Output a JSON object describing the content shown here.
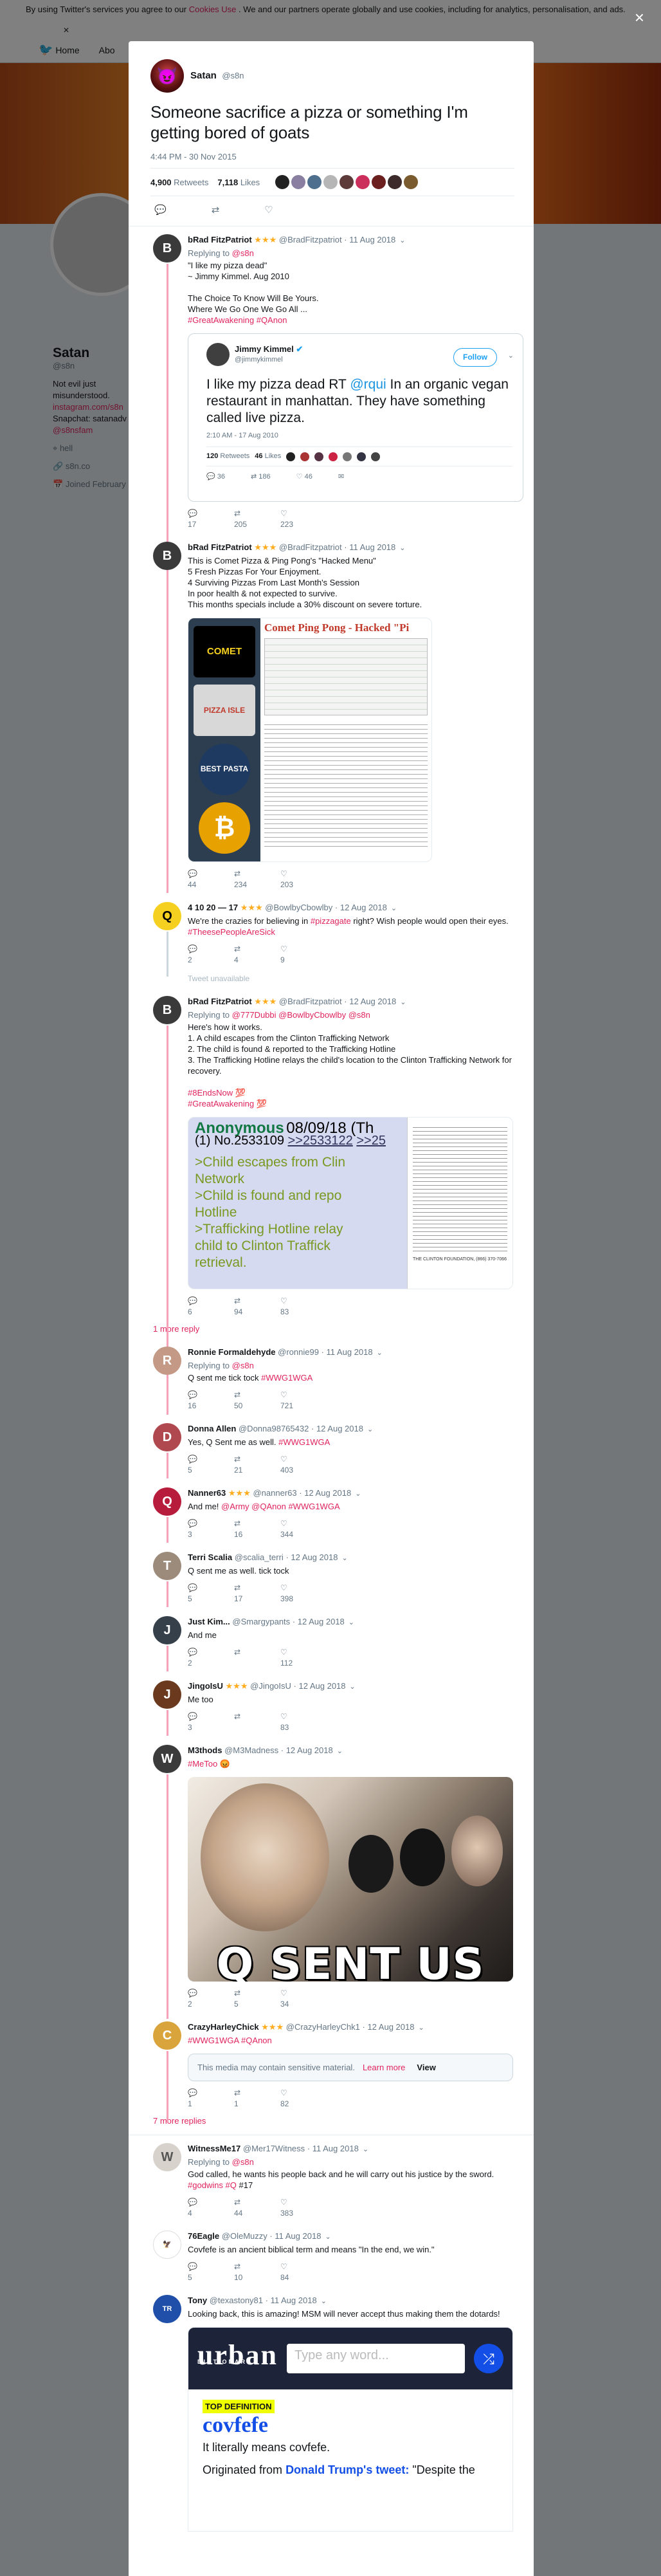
{
  "background": {
    "cookie_text": "By using Twitter's services you agree to our",
    "cookie_link": "Cookies Use",
    "cookie_rest": ". We and our partners operate globally and use cookies, including for analytics, personalisation, and ads.",
    "nav_home": "Home",
    "nav_about": "Abo",
    "profile_name": "Satan",
    "profile_handle": "@s8n",
    "bio_1": "Not evil just misunderstood.",
    "bio_2": "instagram.com/s8n",
    "bio_3": "Snapchat: satanadv",
    "bio_4": "@s8nsfam",
    "location": "hell",
    "website": "s8n.co",
    "joined": "Joined February"
  },
  "modal": {
    "close_label": "×",
    "author_name": "Satan",
    "author_handle": "@s8n",
    "text": "Someone sacrifice a pizza or something I'm getting bored of goats",
    "time": "4:44 PM - 30 Nov 2015",
    "retweets_count": "4,900",
    "retweets_label": "Retweets",
    "likes_count": "7,118",
    "likes_label": "Likes"
  },
  "replies": [
    {
      "name": "bRad FitzPatriot",
      "stars": "★★★",
      "handle": "@BradFitzpatriot",
      "time": "11 Aug 2018",
      "replying_label": "Replying to",
      "replying_to": "@s8n",
      "lines": [
        "\"I like my pizza dead\"",
        "~ Jimmy Kimmel. Aug 2010",
        "",
        "The Choice To Know Will Be Yours.",
        "Where We Go One We Go All ..."
      ],
      "tags": "#GreatAwakening #QAnon",
      "replies": "17",
      "retweets": "205",
      "likes": "223"
    },
    {
      "name": "bRad FitzPatriot",
      "stars": "★★★",
      "handle": "@BradFitzpatriot",
      "time": "11 Aug 2018",
      "lines": [
        "This is Comet Pizza & Ping Pong's \"Hacked Menu\"",
        "5 Fresh Pizzas For Your Enjoyment.",
        "4 Surviving Pizzas From Last Month's Session",
        "In poor health & not expected to survive.",
        "This months specials include a 30% discount on severe torture."
      ],
      "replies": "44",
      "retweets": "234",
      "likes": "203"
    },
    {
      "name": "4 10 20 — 17",
      "stars": "★★★",
      "handle": "@BowlbyCbowlby",
      "time": "12 Aug 2018",
      "text_a": "We're the crazies for believing in ",
      "text_tag": "#pizzagate",
      "text_b": " right? Wish people would open their eyes. ",
      "text_tag2": "#TheesePeopleAreSick",
      "replies": "2",
      "retweets": "4",
      "likes": "9",
      "unavailable": "Tweet unavailable"
    },
    {
      "name": "bRad FitzPatriot",
      "stars": "★★★",
      "handle": "@BradFitzpatriot",
      "time": "12 Aug 2018",
      "replying_label": "Replying to",
      "replying_to": "@777Dubbi @BowlbyCbowlby @s8n",
      "lines": [
        "Here's how it works.",
        "1. A child escapes from the Clinton Trafficking Network",
        "2. The child is found & reported to the Trafficking Hotline",
        "3. The Trafficking Hotline relays the child's location to the Clinton Trafficking Network for recovery.",
        ""
      ],
      "tags": "#8EndsNow",
      "tags2": "#GreatAwakening",
      "replies": "6",
      "retweets": "94",
      "likes": "83",
      "more": "1 more reply"
    },
    {
      "name": "Ronnie Formaldehyde",
      "handle": "@ronnie99",
      "time": "11 Aug 2018",
      "replying_label": "Replying to",
      "replying_to": "@s8n",
      "text": "Q sent me tick tock ",
      "tag": "#WWG1WGA",
      "replies": "16",
      "retweets": "50",
      "likes": "721"
    },
    {
      "name": "Donna Allen",
      "handle": "@Donna98765432",
      "time": "12 Aug 2018",
      "text": "Yes, Q Sent me as well. ",
      "tag": "#WWG1WGA",
      "replies": "5",
      "retweets": "21",
      "likes": "403"
    },
    {
      "name": "Nanner63",
      "stars": "★★★",
      "handle": "@nanner63",
      "time": "12 Aug 2018",
      "text": "And me! ",
      "tag": "@Army @QAnon #WWG1WGA",
      "replies": "3",
      "retweets": "16",
      "likes": "344"
    },
    {
      "name": "Terri Scalia",
      "handle": "@scalia_terri",
      "time": "12 Aug 2018",
      "text": "Q sent me as well. tick tock",
      "replies": "5",
      "retweets": "17",
      "likes": "398"
    },
    {
      "name": "Just Kim...",
      "handle": "@Smargypants",
      "time": "12 Aug 2018",
      "text": "And me",
      "replies": "2",
      "retweets": "",
      "likes": "112"
    },
    {
      "name": "JingoIsU",
      "stars": "★★★",
      "handle": "@JingoIsU",
      "time": "12 Aug 2018",
      "text": "Me too",
      "replies": "3",
      "retweets": "",
      "likes": "83"
    },
    {
      "name": "M3thods",
      "handle": "@M3Madness",
      "time": "12 Aug 2018",
      "tag": "#MeToo",
      "image_caption": "Q SENT US",
      "replies": "2",
      "retweets": "5",
      "likes": "34"
    },
    {
      "name": "CrazyHarleyChick",
      "stars": "★★★",
      "handle": "@CrazyHarleyChk1",
      "time": "12 Aug 2018",
      "tag": "#WWG1WGA #QAnon",
      "sensitive_text": "This media may contain sensitive material.",
      "learn_more": "Learn more",
      "view": "View",
      "replies": "1",
      "retweets": "1",
      "likes": "82",
      "more": "7 more replies"
    },
    {
      "name": "WitnessMe17",
      "handle": "@Mer17Witness",
      "time": "11 Aug 2018",
      "replying_label": "Replying to",
      "replying_to": "@s8n",
      "text": "God called, he wants his people back and he will carry out his justice by the sword. ",
      "tag": "#godwins #Q",
      "text2": " #17",
      "replies": "4",
      "retweets": "44",
      "likes": "383"
    },
    {
      "name": "76Eagle",
      "handle": "@OleMuzzy",
      "time": "11 Aug 2018",
      "text": "Covfefe is an ancient biblical term and means \"In the end, we win.\"",
      "replies": "5",
      "retweets": "10",
      "likes": "84"
    },
    {
      "name": "Tony",
      "handle": "@texastony81",
      "time": "11 Aug 2018",
      "text": "Looking back, this is amazing! MSM will never accept thus making them the dotards!",
      "urban_logo": "urban",
      "urban_sub": "DICTIONARY",
      "urban_placeholder": "Type any word...",
      "urban_topdef": "TOP DEFINITION",
      "urban_word": "covfefe",
      "urban_def": "It literally means covfefe.",
      "urban_orig_a": "Originated from ",
      "urban_orig_b": "Donald Trump's tweet:",
      "urban_orig_c": " \"Despite the"
    }
  ],
  "quoted": {
    "name": "Jimmy Kimmel",
    "handle": "@jimmykimmel",
    "follow": "Follow",
    "text_a": "I like my pizza dead RT ",
    "text_mention": "@rqui",
    "text_b": " In an organic vegan restaurant in manhattan. They have something called live pizza.",
    "time": "2:10 AM - 17 Aug 2010",
    "retweets": "120",
    "retweets_label": "Retweets",
    "likes": "46",
    "likes_label": "Likes",
    "a_replies": "36",
    "a_retweets": "186",
    "a_likes": "46"
  },
  "media_cpp": {
    "title": "Comet Ping Pong - Hacked \"Pi",
    "tile1": "COMET",
    "tile2": "PIZZA ISLE",
    "tile3": "BEST PASTA",
    "tile4": "₿"
  },
  "media_anon": {
    "name": "Anonymous",
    "date": "08/09/18 (Th",
    "no": "(1) No.2533109",
    "link1": ">>2533122",
    "link2": ">>25",
    "g1": ">Child escapes from Clin",
    "g1b": "Network",
    "g2": ">Child is found and repo",
    "g2b": "Hotline",
    "g3": ">Trafficking Hotline relay",
    "g3b": "child to Clinton Traffick",
    "g3c": "retrieval.",
    "foot": "THE CLINTON FOUNDATION, (866) 370-7066"
  },
  "colors": {
    "accent": "#e0245e",
    "link_blue": "#1da1f2",
    "star": "#ffad1f"
  }
}
